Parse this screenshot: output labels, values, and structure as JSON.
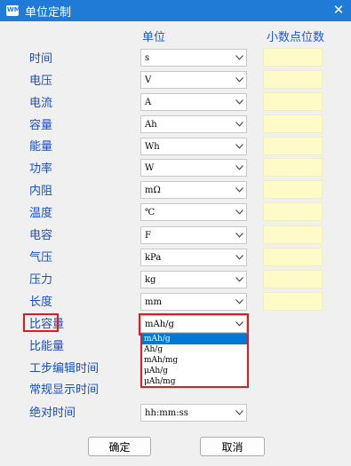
{
  "window": {
    "title": "单位定制",
    "close_glyph": "✕"
  },
  "columns": {
    "unit": "单位",
    "decimals": "小数点位数"
  },
  "rows": [
    {
      "label": "时间",
      "value": "s"
    },
    {
      "label": "电压",
      "value": "V"
    },
    {
      "label": "电流",
      "value": "A"
    },
    {
      "label": "容量",
      "value": "Ah"
    },
    {
      "label": "能量",
      "value": "Wh"
    },
    {
      "label": "功率",
      "value": "W"
    },
    {
      "label": "内阻",
      "value": "mΩ"
    },
    {
      "label": "温度",
      "value": "℃"
    },
    {
      "label": "电容",
      "value": "F"
    },
    {
      "label": "气压",
      "value": "kPa"
    },
    {
      "label": "压力",
      "value": "kg"
    },
    {
      "label": "长度",
      "value": "mm"
    },
    {
      "label": "比容量",
      "value": "mAh/g"
    },
    {
      "label": "比能量",
      "value": ""
    },
    {
      "label": "工步编辑时间",
      "value": ""
    },
    {
      "label": "常规显示时间",
      "value": ""
    },
    {
      "label": "绝对时间",
      "value": "hh:mm:ss"
    }
  ],
  "dropdown": {
    "options": [
      "mAh/g",
      "Ah/g",
      "mAh/mg",
      "μAh/g",
      "μAh/mg"
    ],
    "selected": "mAh/g"
  },
  "buttons": {
    "ok": "确定",
    "cancel": "取消"
  },
  "colors": {
    "titlebar": "#1f7bd6",
    "label_text": "#1a4fc7",
    "highlight": "#e01b22",
    "decimal_cell": "#fffbc8",
    "selection": "#0078d7"
  }
}
